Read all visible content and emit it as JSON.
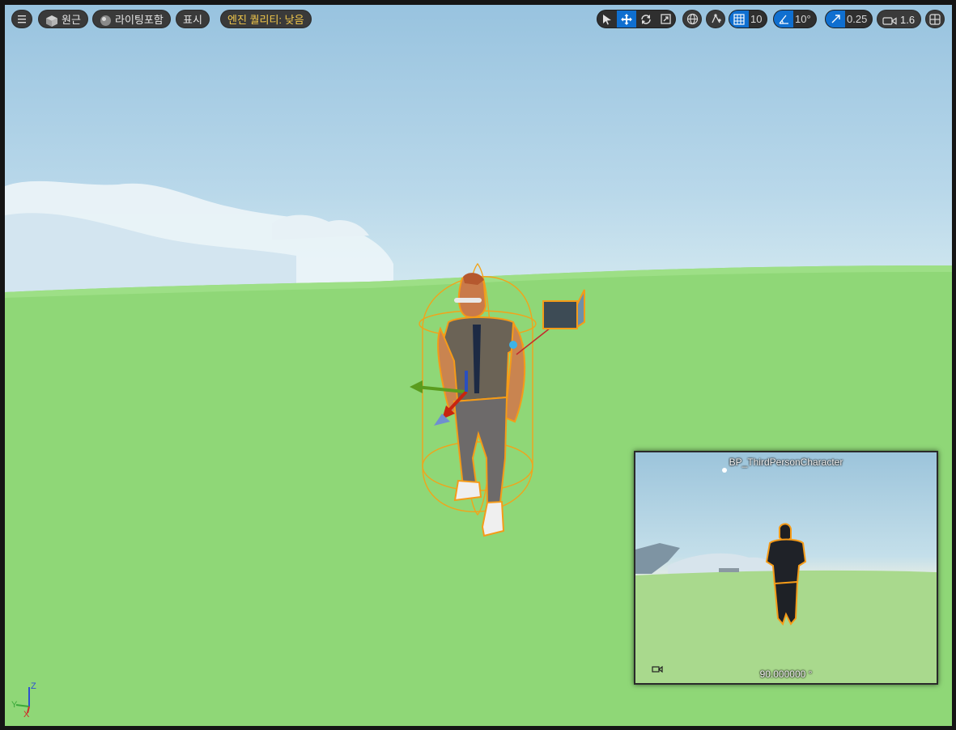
{
  "toolbar": {
    "menu_icon": "hamburger-icon",
    "perspective_label": "원근",
    "lighting_label": "라이팅포함",
    "show_label": "표시",
    "quality_label": "엔진 퀄리티: 낮음",
    "grid_snap_value": "10",
    "rotation_snap_value": "10°",
    "scale_snap_value": "0.25",
    "camera_speed_value": "1.6",
    "colors": {
      "active": "#0f6fd0",
      "quality_text": "#f2c84b"
    }
  },
  "preview": {
    "title": "BP_ThirdPersonCharacter",
    "fov": "90.000000 °"
  },
  "axes": {
    "z": "Z",
    "y": "Y",
    "x": "X"
  }
}
